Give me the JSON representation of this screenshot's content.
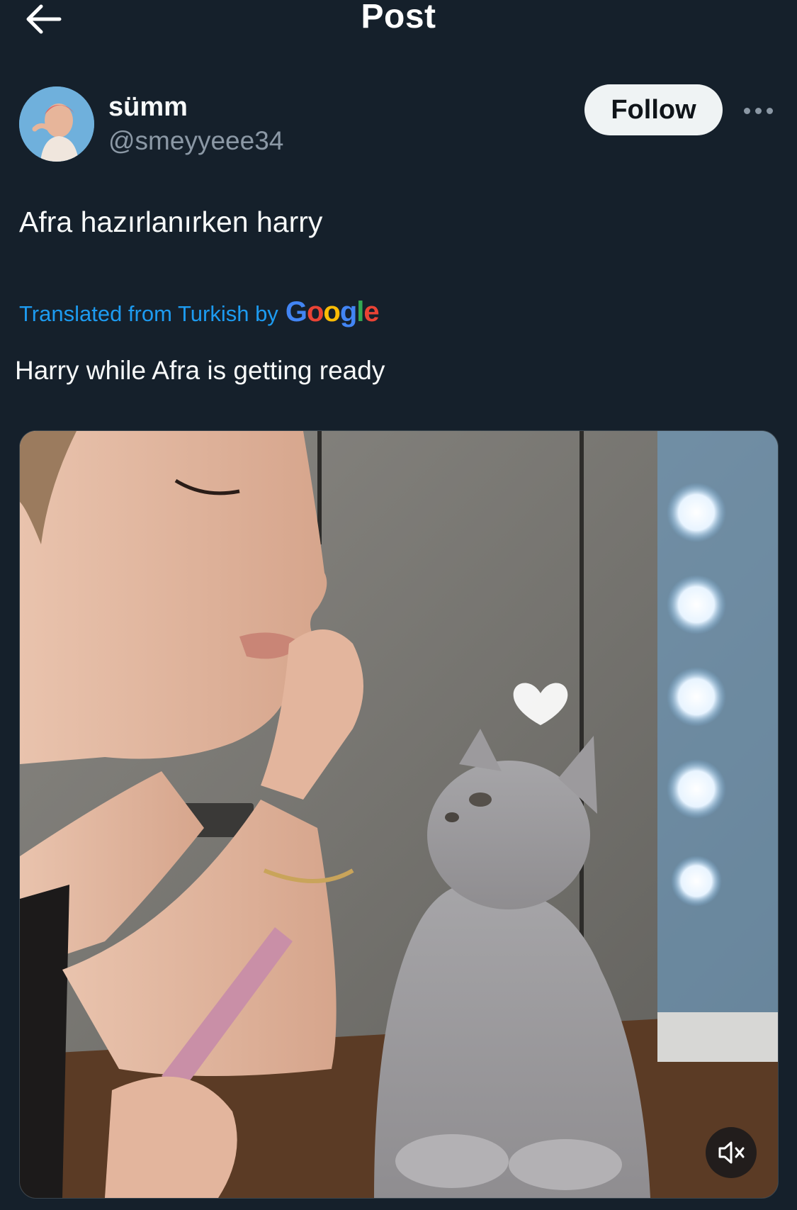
{
  "header": {
    "title": "Post",
    "back_icon": "arrow-left-icon"
  },
  "author": {
    "display_name": "sümm",
    "handle": "@smeyyeee34",
    "follow_label": "Follow",
    "more_icon": "more-horizontal-icon"
  },
  "post": {
    "original_text": "Afra hazırlanırken harry",
    "translation_label": "Translated from Turkish by",
    "translation_provider": "Google",
    "translated_text": "Harry while Afra is getting ready"
  },
  "media": {
    "type": "video",
    "muted_icon": "volume-muted-icon"
  },
  "colors": {
    "background": "#15202b",
    "accent": "#1d9bf0",
    "secondary_text": "#8b98a5",
    "primary_text": "#f7f9f9"
  }
}
